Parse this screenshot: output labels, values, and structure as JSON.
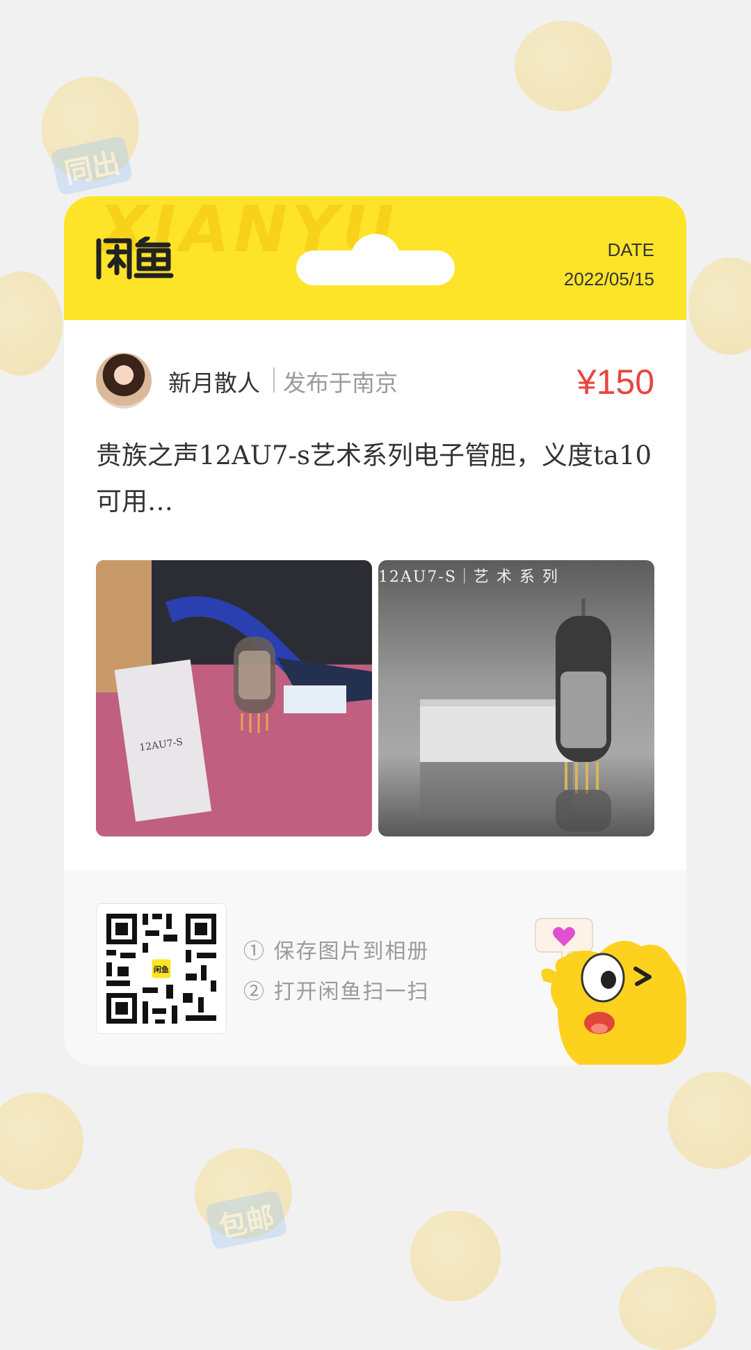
{
  "header": {
    "logo_alt": "闲鱼",
    "watermark": "XIANYU",
    "date_label": "DATE",
    "date_value": "2022/05/15"
  },
  "seller": {
    "name": "新月散人",
    "location": "发布于南京"
  },
  "price": "¥150",
  "description": "贵族之声12AU7-s艺术系列电子管胆，义度ta10可用…",
  "photos": {
    "photo1_box_text": "12AU7-S",
    "photo2_caption": "12AU7-S｜艺 术 系 列"
  },
  "footer": {
    "step1": "① 保存图片到相册",
    "step2": "② 打开闲鱼扫一扫",
    "qr_center_label": "闲鱼"
  },
  "background_tags": [
    "同出",
    "包邮"
  ],
  "colors": {
    "brand_yellow": "#fde428",
    "price_red": "#e9443e",
    "bubble_pink": "#e34fd2"
  }
}
